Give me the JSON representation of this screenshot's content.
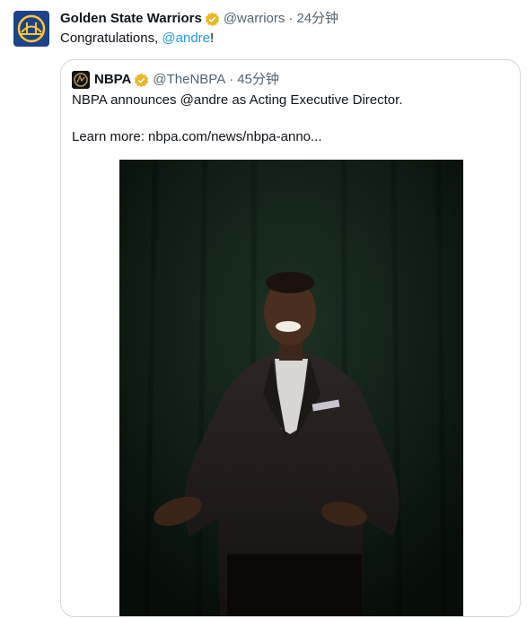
{
  "tweet": {
    "author_name": "Golden State Warriors",
    "author_handle": "@warriors",
    "separator": "·",
    "time": "24分钟",
    "text_prefix": "Congratulations, ",
    "mention": "@andre",
    "text_suffix": "!",
    "avatar_icon": "warriors-bridge-logo-icon",
    "verified_icon": "verified-badge-icon"
  },
  "quote": {
    "author_name": "NBPA",
    "author_handle": "@TheNBPA",
    "separator": "·",
    "time": "45分钟",
    "text_line1": "NBPA announces @andre as Acting Executive Director.",
    "text_line2": "Learn more: nbpa.com/news/nbpa-anno...",
    "avatar_icon": "nbpa-logo-icon",
    "verified_icon": "verified-badge-icon"
  },
  "colors": {
    "link": "#1d9bf0",
    "muted": "#536471",
    "verified_gold": "#e8b829",
    "warriors_blue": "#1d428a",
    "warriors_gold": "#ffc72c",
    "card_border": "#cfd9de"
  }
}
